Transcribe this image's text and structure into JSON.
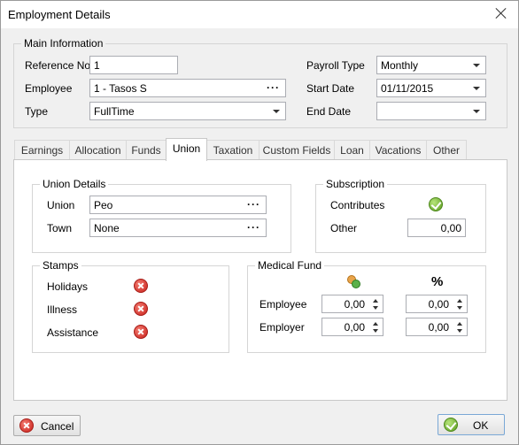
{
  "window": {
    "title": "Employment Details"
  },
  "main_info": {
    "group_label": "Main Information",
    "reference_no": {
      "label": "Reference No",
      "value": "1"
    },
    "employee": {
      "label": "Employee",
      "value": "1 - Tasos S"
    },
    "type": {
      "label": "Type",
      "value": "FullTime"
    },
    "payroll_type": {
      "label": "Payroll Type",
      "value": "Monthly"
    },
    "start_date": {
      "label": "Start Date",
      "value": "01/11/2015"
    },
    "end_date": {
      "label": "End Date",
      "value": ""
    }
  },
  "tabs": [
    "Earnings",
    "Allocation",
    "Funds",
    "Union",
    "Taxation",
    "Custom Fields",
    "Loan",
    "Vacations",
    "Other"
  ],
  "active_tab": "Union",
  "union_details": {
    "group_label": "Union Details",
    "union": {
      "label": "Union",
      "value": "Peo"
    },
    "town": {
      "label": "Town",
      "value": "None"
    }
  },
  "subscription": {
    "group_label": "Subscription",
    "contributes_label": "Contributes",
    "contributes": true,
    "other": {
      "label": "Other",
      "value": "0,00"
    }
  },
  "stamps": {
    "group_label": "Stamps",
    "items": [
      {
        "label": "Holidays",
        "checked": false
      },
      {
        "label": "Illness",
        "checked": false
      },
      {
        "label": "Assistance",
        "checked": false
      }
    ]
  },
  "medical_fund": {
    "group_label": "Medical Fund",
    "percent_header": "%",
    "rows": [
      {
        "label": "Employee",
        "amount": "0,00",
        "percent": "0,00"
      },
      {
        "label": "Employer",
        "amount": "0,00",
        "percent": "0,00"
      }
    ]
  },
  "buttons": {
    "cancel": "Cancel",
    "ok": "OK"
  },
  "colors": {
    "accent_red": "#c9211b",
    "accent_green": "#5a9b1f",
    "panel_bg": "#ffffff",
    "window_bg": "#f0f0f0"
  }
}
